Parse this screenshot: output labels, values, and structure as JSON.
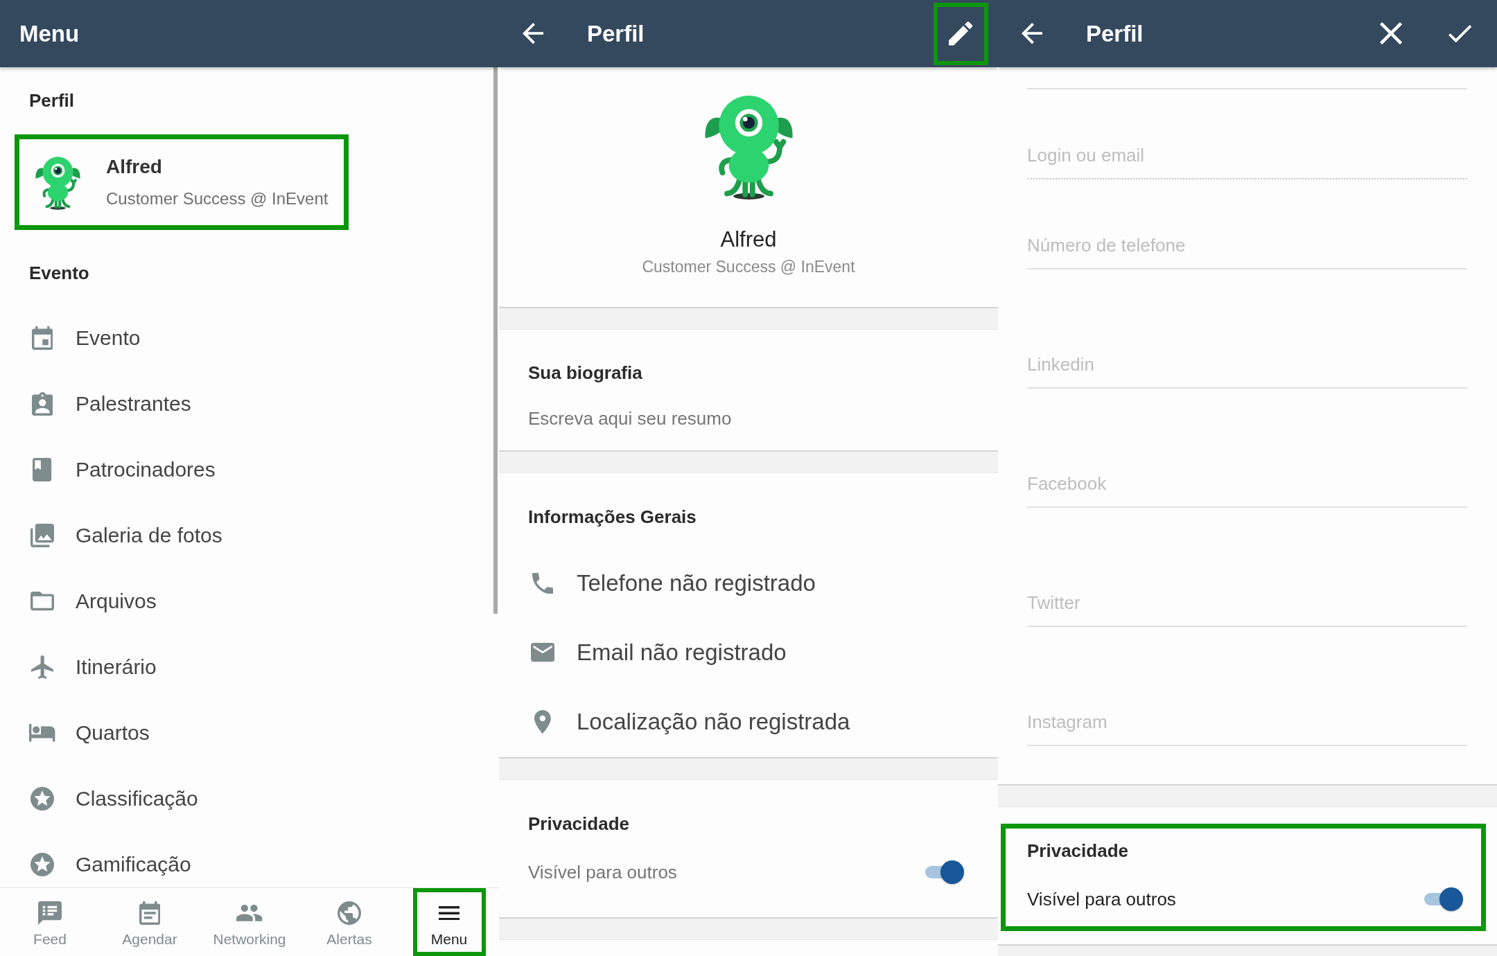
{
  "menu_screen": {
    "title": "Menu",
    "profile_section": {
      "label": "Perfil",
      "card": {
        "name": "Alfred",
        "subtitle": "Customer Success @ InEvent",
        "highlighted": true
      }
    },
    "event_section": {
      "label": "Evento",
      "items": [
        {
          "kind": "event",
          "label": "Evento"
        },
        {
          "kind": "speakers",
          "label": "Palestrantes"
        },
        {
          "kind": "sponsors",
          "label": "Patrocinadores"
        },
        {
          "kind": "gallery",
          "label": "Galeria de fotos"
        },
        {
          "kind": "files",
          "label": "Arquivos"
        },
        {
          "kind": "itinerary",
          "label": "Itinerário"
        },
        {
          "kind": "rooms",
          "label": "Quartos"
        },
        {
          "kind": "ranking",
          "label": "Classificação"
        },
        {
          "kind": "gamification",
          "label": "Gamificação"
        }
      ]
    },
    "bottom_nav": [
      {
        "kind": "feed",
        "label": "Feed",
        "selected": false,
        "highlighted": false
      },
      {
        "kind": "agenda",
        "label": "Agendar",
        "selected": false,
        "highlighted": false
      },
      {
        "kind": "networking",
        "label": "Networking",
        "selected": false,
        "highlighted": false
      },
      {
        "kind": "alerts",
        "label": "Alertas",
        "selected": false,
        "highlighted": false
      },
      {
        "kind": "menu",
        "label": "Menu",
        "selected": true,
        "highlighted": true
      }
    ]
  },
  "profile_screen": {
    "title": "Perfil",
    "actions": [
      {
        "kind": "edit",
        "highlighted": true
      }
    ],
    "name": "Alfred",
    "subtitle": "Customer Success @ InEvent",
    "bio": {
      "title": "Sua biografia",
      "text": "Escreva aqui seu resumo"
    },
    "general_info": {
      "title": "Informações Gerais",
      "items": [
        {
          "kind": "phone",
          "text": "Telefone não registrado"
        },
        {
          "kind": "email",
          "text": "Email não registrado"
        },
        {
          "kind": "location",
          "text": "Localização não registrada"
        }
      ]
    },
    "privacy": {
      "title": "Privacidade",
      "label": "Visível para outros",
      "on": true,
      "highlighted": false
    }
  },
  "edit_profile_screen": {
    "title": "Perfil",
    "actions": [
      {
        "kind": "close",
        "highlighted": false
      },
      {
        "kind": "confirm",
        "highlighted": false
      }
    ],
    "fields": [
      {
        "placeholder": "Login ou email",
        "disabled": true
      },
      {
        "placeholder": "Número de telefone",
        "disabled": false
      }
    ],
    "social_fields": [
      {
        "placeholder": "Linkedin"
      },
      {
        "placeholder": "Facebook"
      },
      {
        "placeholder": "Twitter"
      },
      {
        "placeholder": "Instagram"
      }
    ],
    "privacy": {
      "title": "Privacidade",
      "label": "Visível para outros",
      "on": true,
      "highlighted": true
    }
  }
}
